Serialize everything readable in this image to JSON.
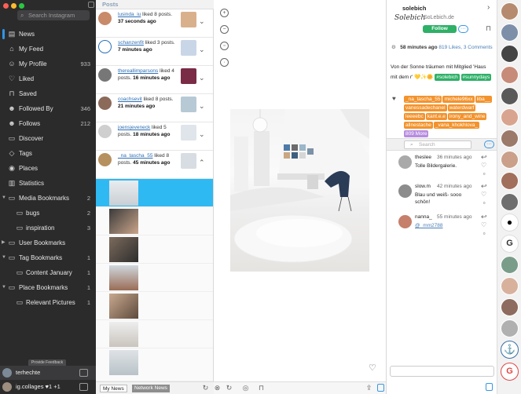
{
  "sidebar": {
    "search_placeholder": "Search Instagram",
    "items": [
      {
        "label": "News",
        "icon": "news-icon",
        "count": ""
      },
      {
        "label": "My Feed",
        "icon": "home-icon",
        "count": ""
      },
      {
        "label": "My Profile",
        "icon": "profile-icon",
        "count": "933"
      },
      {
        "label": "Liked",
        "icon": "heart-icon",
        "count": ""
      },
      {
        "label": "Saved",
        "icon": "bookmark-icon",
        "count": ""
      },
      {
        "label": "Followed By",
        "icon": "followed-by-icon",
        "count": "346"
      },
      {
        "label": "Follows",
        "icon": "follows-icon",
        "count": "212"
      },
      {
        "label": "Discover",
        "icon": "discover-icon",
        "count": ""
      },
      {
        "label": "Tags",
        "icon": "tag-icon",
        "count": ""
      },
      {
        "label": "Places",
        "icon": "pin-icon",
        "count": ""
      },
      {
        "label": "Statistics",
        "icon": "chart-icon",
        "count": ""
      },
      {
        "label": "Media Bookmarks",
        "icon": "folder-icon",
        "count": "2"
      },
      {
        "label": "bugs",
        "icon": "folder-icon",
        "count": "2"
      },
      {
        "label": "inspiration",
        "icon": "folder-icon",
        "count": "3"
      },
      {
        "label": "User Bookmarks",
        "icon": "folder-icon",
        "count": ""
      },
      {
        "label": "Tag Bookmarks",
        "icon": "folder-icon",
        "count": "1"
      },
      {
        "label": "Content January",
        "icon": "folder-icon",
        "count": "1"
      },
      {
        "label": "Place Bookmarks",
        "icon": "folder-icon",
        "count": "1"
      },
      {
        "label": "Relevant Pictures",
        "icon": "folder-icon",
        "count": "1"
      }
    ],
    "feedback": "Provide Feedback",
    "accounts": [
      {
        "name": "terhechte"
      },
      {
        "name": "ig.collages ♥1 +1"
      }
    ]
  },
  "notifications": {
    "header": "Posts",
    "rows": [
      {
        "user": "lusinda_iu",
        "action": " liked 8 posts. ",
        "time": "37 seconds ago",
        "color": "#c98a6a",
        "thumb": "#d9b08c"
      },
      {
        "user": "schanzenfit",
        "action": " liked 3 posts. ",
        "time": "7 minutes ago",
        "color": "#2a73b8",
        "thumb": "#c9d6e8"
      },
      {
        "user": "thereallimparsons",
        "action": " liked 4 posts. ",
        "time": "16 minutes ago",
        "color": "#777",
        "thumb": "#7a2b45"
      },
      {
        "user": "coachsevit",
        "action": " liked 8 posts. ",
        "time": "21 minutes ago",
        "color": "#8b6a5a",
        "thumb": "#b6c9d5"
      },
      {
        "user": "joensjeveneck",
        "action": " liked 5 posts. ",
        "time": "18 minutes ago",
        "color": "#cfcfcf",
        "thumb": "#dfe5ea"
      },
      {
        "user": "_na_tascha_55",
        "action": " liked 8 posts. ",
        "time": "45 minutes ago",
        "color": "#b7905f",
        "thumb": "#d7dde2"
      }
    ],
    "tabs": {
      "my": "My News",
      "network": "Network News"
    }
  },
  "detail": {
    "username": "solebich",
    "logo": "Solebich",
    "site": "SoLebich.de",
    "follow": "Follow",
    "meta_time": "58 minutes ago",
    "meta_likes": "819 Likes, 3 Comments",
    "caption": "Von der Sonne träumen mit Mitglied 'Haus mit dem r' 💛✨🌼",
    "hashtags": [
      "#solebich",
      "#sunnydays"
    ],
    "user_tags": [
      "_na_tascha_55",
      "michele96xx",
      "liba__",
      "vanessadechanel",
      "waterdwarf",
      "leeeebc",
      "kant.e.e",
      "irony_and_wine",
      "allnestache",
      "_vana_khokhlova_"
    ],
    "more_tags": "809 More",
    "comment_search": "Search",
    "comments": [
      {
        "user": "theslee",
        "time": "36 minutes ago",
        "text": "Tolle Bildergalerie.",
        "count": "0",
        "color": "#a9a9a9"
      },
      {
        "user": "slow.m",
        "time": "42 minutes ago",
        "text": "Blau und weiß- sooo schön!",
        "count": "0",
        "color": "#8c8c8c"
      },
      {
        "user": "nanna_",
        "time": "55 minutes ago",
        "text": "@_mm2788",
        "count": "0",
        "color": "#c57f6a"
      }
    ]
  },
  "avatars": [
    "#b58a6e",
    "#7d8fa8",
    "#444",
    "#c78b7a",
    "#5a5a5a",
    "#d9a48f",
    "#9b7a6a",
    "#caa08a",
    "#a16f5c",
    "#6e6e6e",
    "#000000",
    "#ffffff",
    "#7a9d8a",
    "#d8b19d",
    "#8d6b5e",
    "#b0b0b0",
    "#3a6ea8",
    "#e04646"
  ]
}
